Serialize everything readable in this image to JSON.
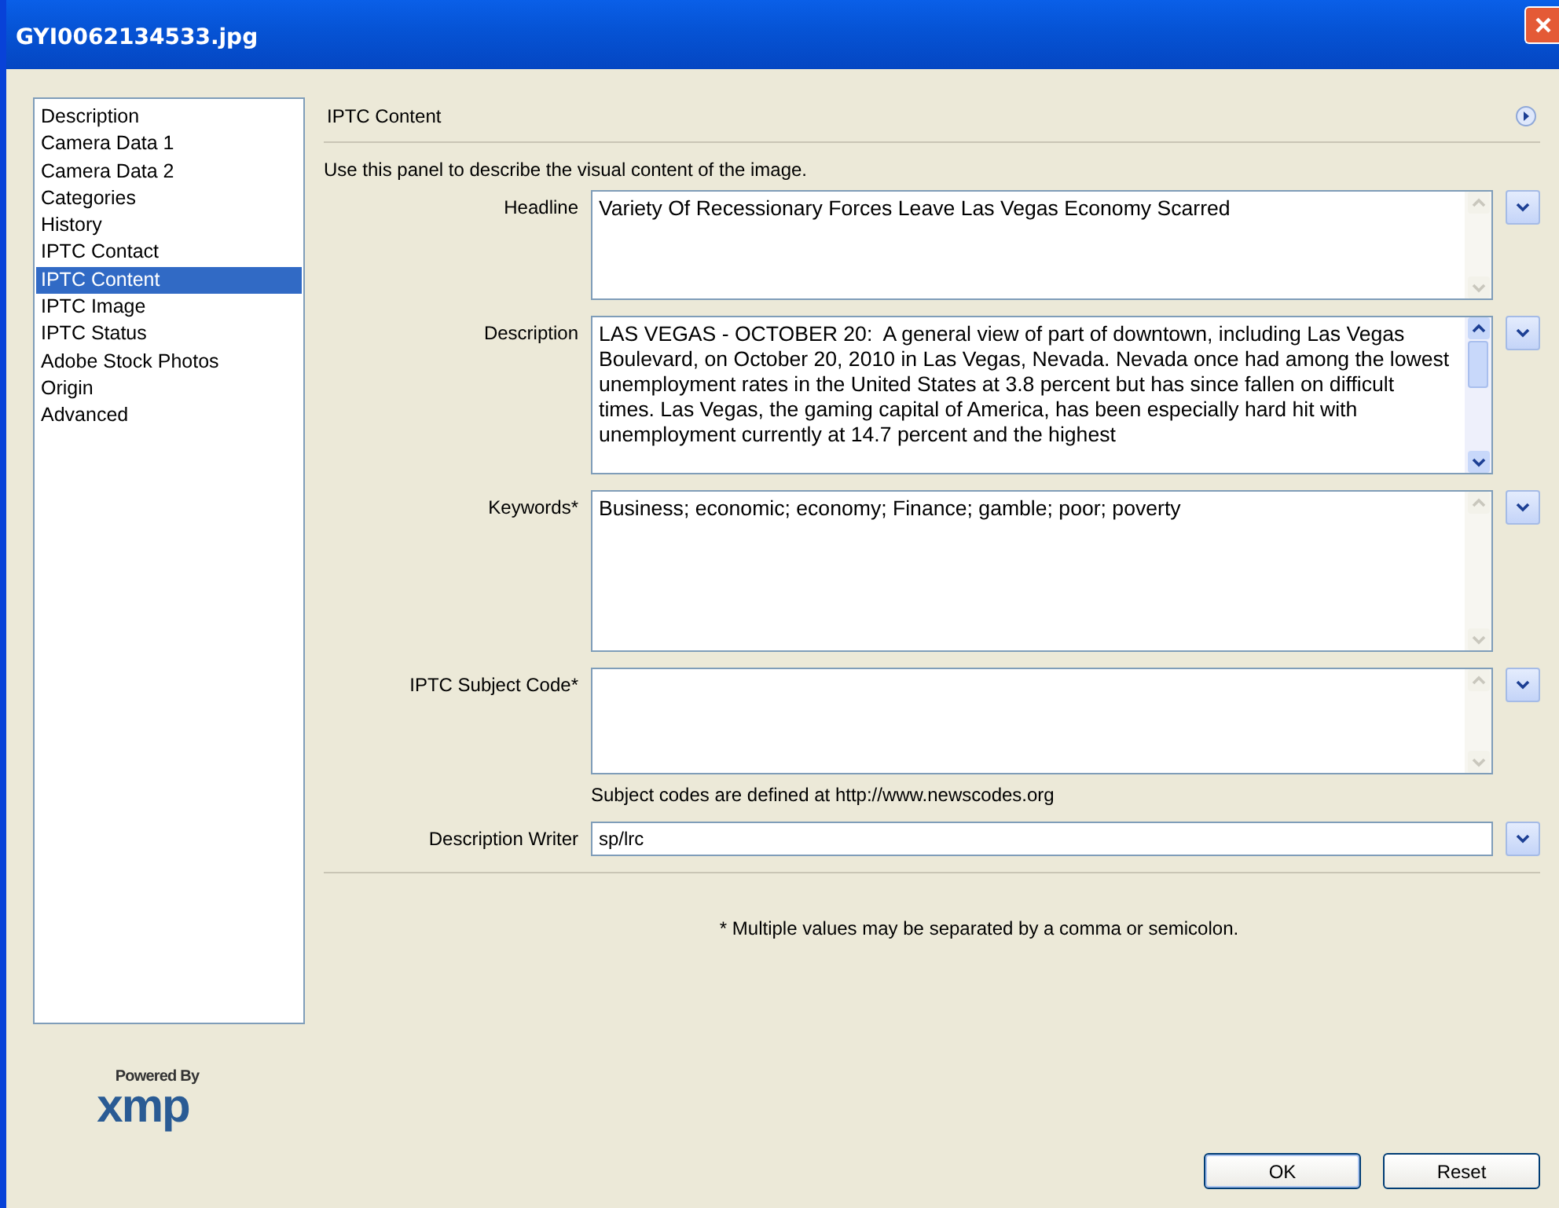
{
  "window": {
    "title": "GYI0062134533.jpg"
  },
  "sidebar": {
    "items": [
      {
        "label": "Description",
        "selected": false
      },
      {
        "label": "Camera Data 1",
        "selected": false
      },
      {
        "label": "Camera Data 2",
        "selected": false
      },
      {
        "label": "Categories",
        "selected": false
      },
      {
        "label": "History",
        "selected": false
      },
      {
        "label": "IPTC Contact",
        "selected": false
      },
      {
        "label": "IPTC Content",
        "selected": true
      },
      {
        "label": "IPTC Image",
        "selected": false
      },
      {
        "label": "IPTC Status",
        "selected": false
      },
      {
        "label": "Adobe Stock Photos",
        "selected": false
      },
      {
        "label": "Origin",
        "selected": false
      },
      {
        "label": "Advanced",
        "selected": false
      }
    ]
  },
  "logo": {
    "caption": "Powered By",
    "wordmark": "xmp"
  },
  "panel": {
    "title": "IPTC Content",
    "intro": "Use this panel to describe the visual content of the image.",
    "fields": [
      {
        "kind": "multiline",
        "label": "Headline",
        "value": "Variety Of Recessionary Forces Leave Las Vegas Economy Scarred",
        "scrollable": false
      },
      {
        "kind": "multiline",
        "label": "Description",
        "value": "LAS VEGAS - OCTOBER 20:  A general view of part of downtown, including Las Vegas Boulevard, on October 20, 2010 in Las Vegas, Nevada. Nevada once had among the lowest unemployment rates in the United States at 3.8 percent but has since fallen on difficult times. Las Vegas, the gaming capital of America, has been especially hard hit with unemployment currently at 14.7 percent and the highest",
        "scrollable": true
      },
      {
        "kind": "multiline",
        "label": "Keywords*",
        "value": "Business; economic; economy; Finance; gamble; poor; poverty",
        "scrollable": false
      },
      {
        "kind": "multiline",
        "label": "IPTC Subject Code*",
        "scrollable": false
      },
      {
        "kind": "note",
        "text": "Subject codes are defined at http://www.newscodes.org"
      },
      {
        "kind": "single",
        "label": "Description Writer",
        "value": "sp/lrc"
      }
    ],
    "footnote": "* Multiple values may be separated by a comma or semicolon."
  },
  "buttons": [
    "OK",
    "Reset"
  ]
}
